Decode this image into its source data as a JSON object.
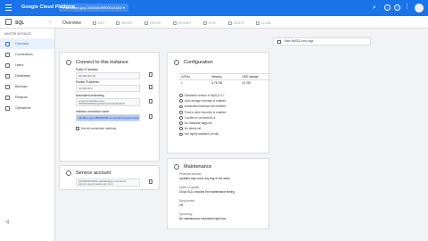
{
  "topbar": {
    "brand": "Google Cloud Platform",
    "project": "▾ sandbox-gcp-0000AA0000001A0A0 ▾",
    "icons": [
      "search-icon",
      "console-icon",
      "notifications-icon",
      "help-icon",
      "more-icon"
    ],
    "accent_color": "#1a73e8"
  },
  "subbar": {
    "product": "SQL",
    "title": "Overview",
    "actions": [
      "EDIT",
      "IMPORT",
      "EXPORT",
      "RESTART",
      "STOP",
      "DELETE",
      "CLONE"
    ]
  },
  "sidebar": {
    "section_label": "MASTER INSTANCE",
    "items": [
      {
        "label": "Overview",
        "active": true
      },
      {
        "label": "Connections",
        "active": false
      },
      {
        "label": "Users",
        "active": false
      },
      {
        "label": "Databases",
        "active": false
      },
      {
        "label": "Backups",
        "active": false
      },
      {
        "label": "Replicas",
        "active": false
      },
      {
        "label": "Operations",
        "active": false
      }
    ]
  },
  "connect": {
    "title": "Connect to this instance",
    "public_ip_label": "Public IP address",
    "public_ip": "35.000.000.00",
    "private_ip_label": "Private IP address",
    "private_ip": "10.000.00.0",
    "networking_label": "Associated networking",
    "networking": "projects/sandbox-gcp-000000000000/global/networks/default",
    "conn_name_label": "Instance connection name",
    "conn_name": "sandbox-gcp-000000000:us-central1:mysql-instance",
    "see_all": "See all connection methods"
  },
  "service_account": {
    "title": "Service account",
    "value": "p000000000000-a0a0a0@gcp-sa-cloud-sql.iam.gserviceaccount.com"
  },
  "configuration": {
    "title": "Configuration",
    "headers": [
      "vCPUs",
      "Memory",
      "SSD storage"
    ],
    "values": [
      "1",
      "3.75 GB",
      "10 GB"
    ],
    "features": [
      "Database version is MySQL 5.7",
      "Auto storage increase is enabled",
      "Automated backups are enabled",
      "Point-in-time recovery is enabled",
      "Located in us-central1-a",
      "No database flags set",
      "No labels set",
      "Not highly available (zonal)"
    ]
  },
  "maintenance": {
    "title": "Maintenance",
    "preferred_label": "Preferred window",
    "preferred_value": "Updates may occur any day of the week",
    "order_label": "Order of update",
    "order_value": "Cloud SQL chooses the maintenance timing",
    "deny_label": "Deny period",
    "deny_value": "Off",
    "upcoming_label": "Upcoming",
    "upcoming_value": "No maintenance scheduled right now"
  },
  "mysql_logs": "View MySQL error logs"
}
